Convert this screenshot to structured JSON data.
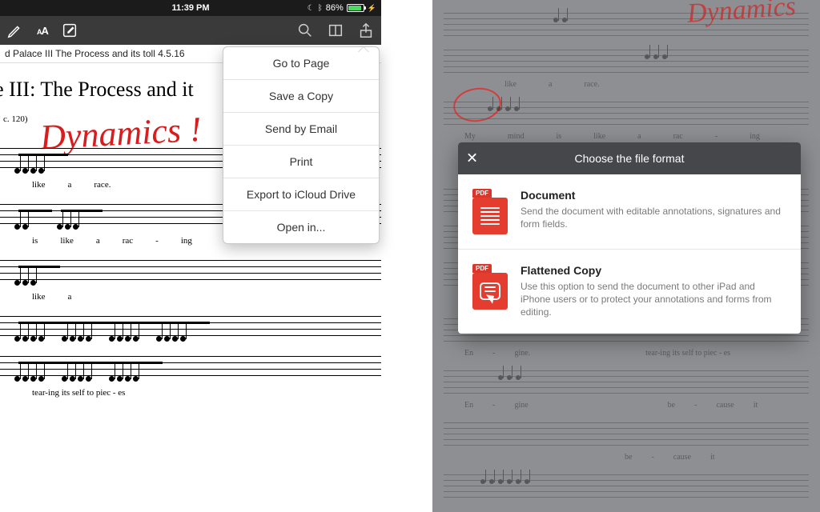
{
  "status": {
    "time": "11:39 PM",
    "battery_pct": "86%"
  },
  "toolbar": {
    "doc_title": "d Palace III The Process and its toll 4.5.16"
  },
  "page": {
    "title": "ace III: The Process and it",
    "tempo": "c. 120)",
    "handwriting": "Dynamics !"
  },
  "lyrics": {
    "row1": [
      "like",
      "a",
      "race."
    ],
    "row2": [
      "is",
      "like",
      "a",
      "rac",
      "-",
      "ing"
    ],
    "row3": [
      "like",
      "a"
    ],
    "row4": [
      "tear-ing its self to piec - es"
    ]
  },
  "menu": {
    "items": [
      "Go to Page",
      "Save a Copy",
      "Send by Email",
      "Print",
      "Export to iCloud Drive",
      "Open in..."
    ]
  },
  "right": {
    "handwriting": "Dynamics",
    "lyrics_a": [
      "like",
      "a",
      "race."
    ],
    "lyrics_b": [
      "My",
      "mind",
      "is",
      "like",
      "a",
      "rac",
      "-",
      "ing"
    ],
    "lyrics_c": [
      "En",
      "-",
      "gine.",
      "tear-ing its self to piec - es"
    ],
    "lyrics_d": [
      "En",
      "-",
      "gine",
      "be",
      "-",
      "cause",
      "it"
    ],
    "lyrics_e": [
      "be",
      "-",
      "cause",
      "it"
    ]
  },
  "modal": {
    "title": "Choose the file format",
    "pdf_label": "PDF",
    "options": [
      {
        "title": "Document",
        "desc": "Send the document with editable annotations, signatures and form fields."
      },
      {
        "title": "Flattened Copy",
        "desc": "Use this option to send the document to other iPad and iPhone users or to protect your annotations and forms from editing."
      }
    ]
  }
}
